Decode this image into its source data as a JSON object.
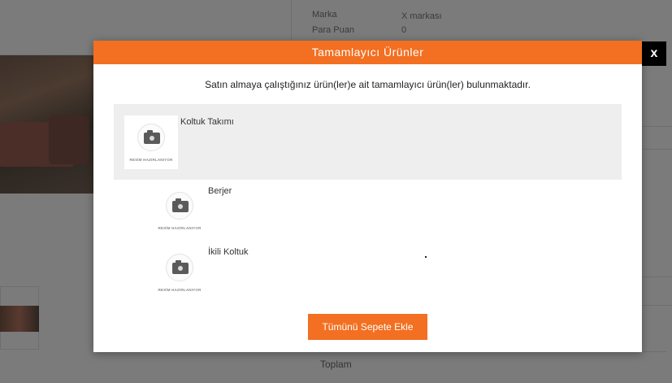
{
  "background": {
    "specs": [
      {
        "label": "Marka",
        "value": "X markası"
      },
      {
        "label": "Para Puan",
        "value": "0"
      }
    ],
    "total_label": "Toplam"
  },
  "modal": {
    "title": "Tamamlayıcı Ürünler",
    "close_label": "x",
    "message": "Satın almaya çalıştığınız ürün(ler)e ait tamamlayıcı ürün(ler) bulunmaktadır.",
    "placeholder_caption": "RESİM HAZIRLANIYOR",
    "items": [
      {
        "name": "Koltuk Takımı",
        "icon": "camera-placeholder-icon"
      },
      {
        "name": "Berjer",
        "icon": "camera-placeholder-icon"
      },
      {
        "name": "İkili Koltuk",
        "icon": "camera-placeholder-icon"
      }
    ],
    "add_all_label": "Tümünü Sepete Ekle"
  },
  "colors": {
    "accent": "#f36f21",
    "overlay": "#7b7b7b",
    "close_bg": "#000000"
  }
}
